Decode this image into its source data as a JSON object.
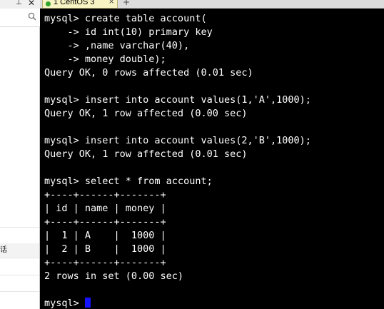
{
  "side_panel": {
    "icons": {
      "pin": "pin-icon",
      "close": "close-icon",
      "search": "search-icon"
    },
    "partial_text": "话"
  },
  "tab": {
    "label": "1 CentOS 3",
    "close_glyph": "×",
    "add_glyph": "+",
    "status_color": "#2fa52f"
  },
  "terminal": {
    "background": "#000000",
    "foreground": "#ffffff",
    "cursor_color": "#1414ff",
    "lines": [
      "mysql> create table account(",
      "    -> id int(10) primary key",
      "    -> ,name varchar(40),",
      "    -> money double);",
      "Query OK, 0 rows affected (0.01 sec)",
      "",
      "mysql> insert into account values(1,'A',1000);",
      "Query OK, 1 row affected (0.00 sec)",
      "",
      "mysql> insert into account values(2,'B',1000);",
      "Query OK, 1 row affected (0.01 sec)",
      "",
      "mysql> select * from account;",
      "+----+------+-------+",
      "| id | name | money |",
      "+----+------+-------+",
      "|  1 | A    |  1000 |",
      "|  2 | B    |  1000 |",
      "+----+------+-------+",
      "2 rows in set (0.00 sec)",
      "",
      "mysql> "
    ]
  }
}
